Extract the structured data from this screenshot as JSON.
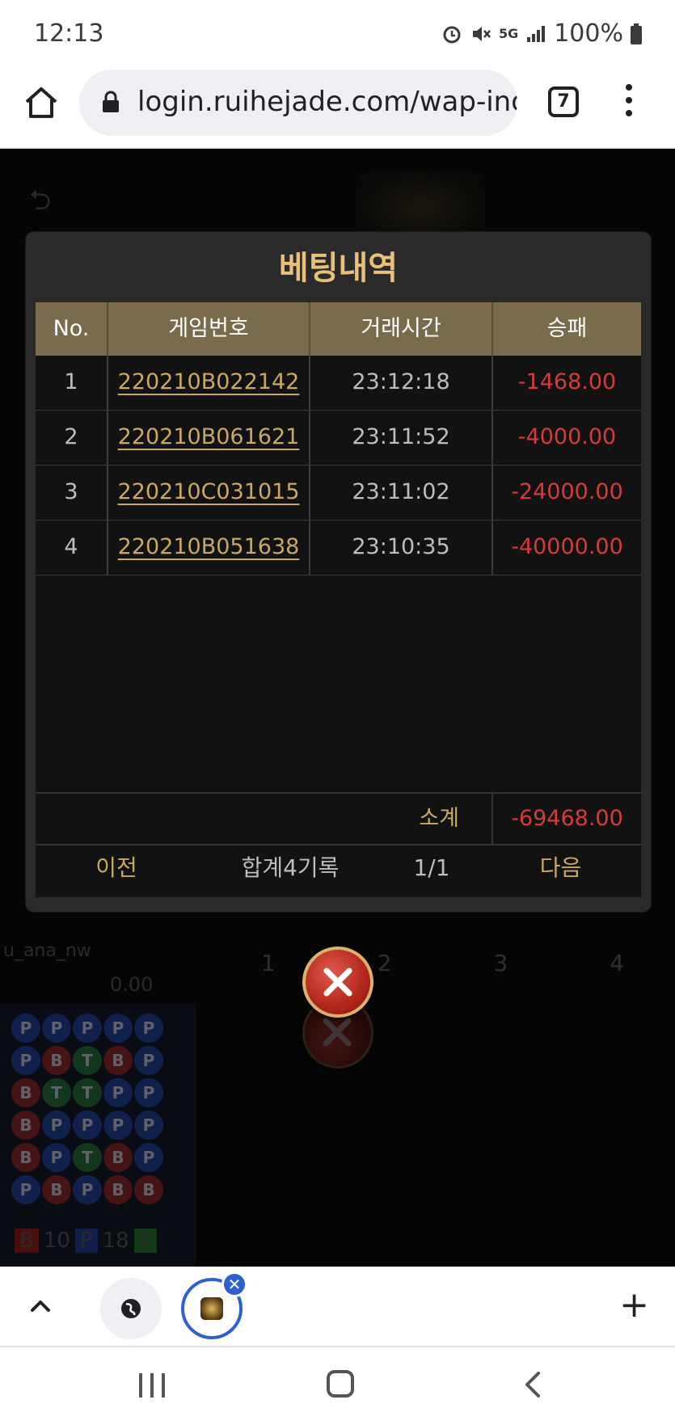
{
  "status_bar": {
    "time": "12:13",
    "network": "5G",
    "battery": "100%"
  },
  "browser": {
    "url": "login.ruihejade.com/wap-ind",
    "tab_count": "7"
  },
  "modal": {
    "title": "베팅내역",
    "columns": [
      "No.",
      "게임번호",
      "거래시간",
      "승패"
    ],
    "rows": [
      {
        "no": "1",
        "game_id": "220210B022142",
        "time": "23:12:18",
        "result": "-1468.00"
      },
      {
        "no": "2",
        "game_id": "220210B061621",
        "time": "23:11:52",
        "result": "-4000.00"
      },
      {
        "no": "3",
        "game_id": "220210C031015",
        "time": "23:11:02",
        "result": "-24000.00"
      },
      {
        "no": "4",
        "game_id": "220210B051638",
        "time": "23:10:35",
        "result": "-40000.00"
      }
    ],
    "subtotal_label": "소계",
    "subtotal_value": "-69468.00",
    "pager": {
      "prev": "이전",
      "total": "합계4기록",
      "page": "1/1",
      "next": "다음"
    }
  },
  "background": {
    "tabs": [
      "1",
      "2",
      "3",
      "4"
    ],
    "score": "0.00",
    "user": "u_ana_nw",
    "counts": {
      "b": "10",
      "p": "18",
      "t": "T"
    }
  },
  "colors": {
    "accent_gold": "#caa862",
    "title_gold": "#e8c07a",
    "negative_red": "#d63b3b",
    "header_brown": "#7b6b4d",
    "tab_blue": "#2f5fd0"
  }
}
